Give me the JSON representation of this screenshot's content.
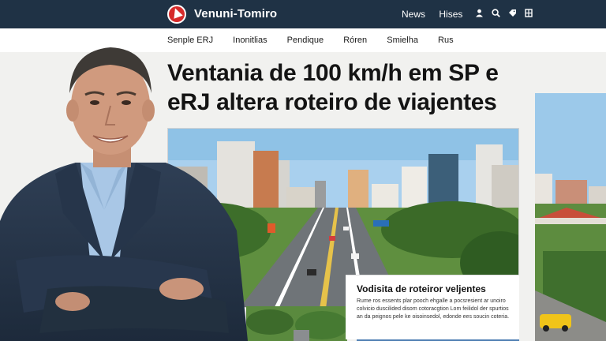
{
  "header": {
    "brand": "Venuni-Tomiro",
    "nav": [
      "News",
      "Hises"
    ],
    "icons": [
      "user-icon",
      "search-icon",
      "tag-icon",
      "bookmark-icon"
    ]
  },
  "subnav": {
    "items": [
      "Senple ERJ",
      "Inonitlias",
      "Pendique",
      "Róren",
      "Smielha",
      "Rus"
    ]
  },
  "article": {
    "headline_line1": "Ventania de 100 km/h em SP e",
    "headline_line2": "eRJ altera roteiro de viajentes"
  },
  "card": {
    "title": "Vodisita de roteiror veljentes",
    "text": "Rume ros essents plar pooch ehgalle a pocsresient ar unoiro colvicio duscilided disom cotoracgtion Lom feilidol der spurtios an da peignos pele ke oisoinsedol, edonde ees soucin coteria."
  },
  "colors": {
    "header_bg": "#1f3245",
    "logo_red": "#d62b2b",
    "page_bg": "#f1f1ef"
  }
}
